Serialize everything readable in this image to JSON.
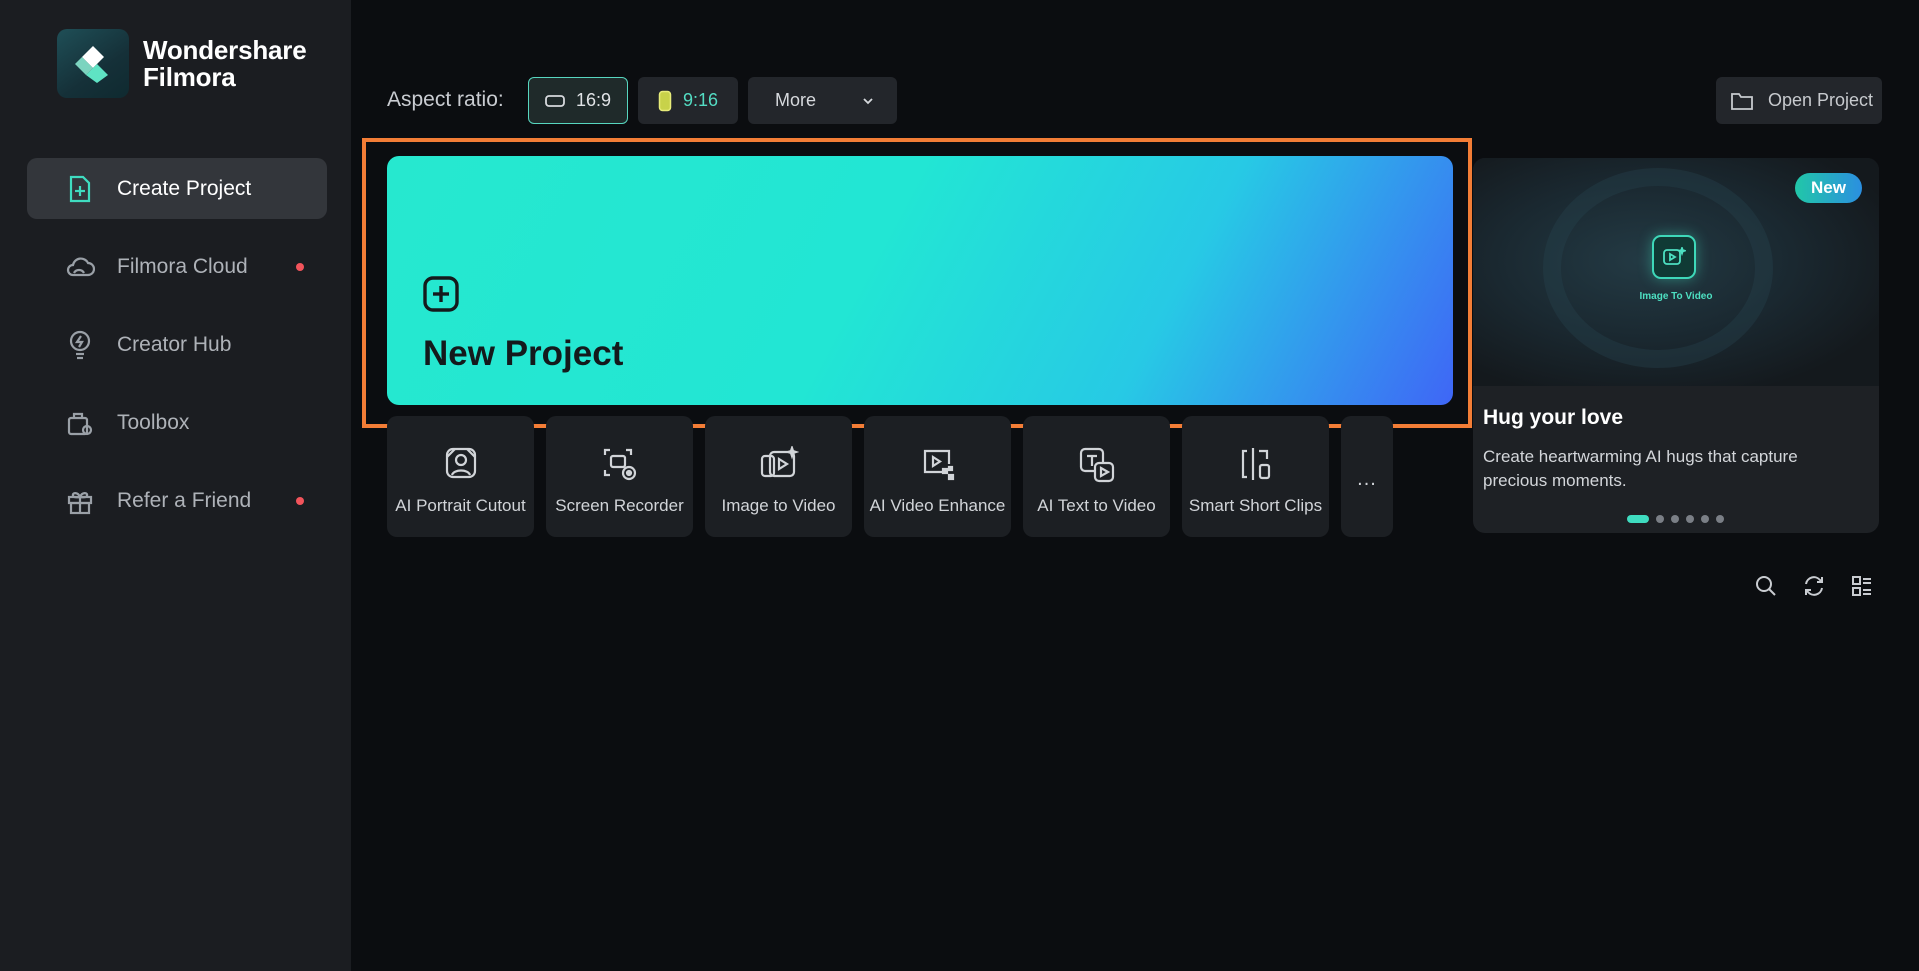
{
  "brand": {
    "line1": "Wondershare",
    "line2": "Filmora"
  },
  "sidebar": {
    "items": [
      {
        "label": "Create Project",
        "icon": "create-project-icon",
        "active": true,
        "dot": false
      },
      {
        "label": "Filmora Cloud",
        "icon": "cloud-icon",
        "active": false,
        "dot": true
      },
      {
        "label": "Creator Hub",
        "icon": "lightbulb-icon",
        "active": false,
        "dot": false
      },
      {
        "label": "Toolbox",
        "icon": "toolbox-icon",
        "active": false,
        "dot": false
      },
      {
        "label": "Refer a Friend",
        "icon": "gift-icon",
        "active": false,
        "dot": true
      }
    ]
  },
  "topbar": {
    "aspect_label": "Aspect ratio:",
    "ratio_16_9": "16:9",
    "ratio_9_16": "9:16",
    "more_label": "More",
    "open_project_label": "Open Project"
  },
  "new_project": {
    "label": "New Project"
  },
  "tools": [
    {
      "label": "AI Portrait Cutout",
      "icon": "portrait-cutout-icon"
    },
    {
      "label": "Screen Recorder",
      "icon": "screen-recorder-icon"
    },
    {
      "label": "Image to Video",
      "icon": "image-to-video-icon"
    },
    {
      "label": "AI Video Enhance",
      "icon": "video-enhance-icon"
    },
    {
      "label": "AI Text to Video",
      "icon": "text-to-video-icon"
    },
    {
      "label": "Smart Short Clips",
      "icon": "short-clips-icon"
    }
  ],
  "tools_more": "...",
  "promo": {
    "badge": "New",
    "hero_caption": "Image To Video",
    "title": "Hug your love",
    "description": "Create heartwarming AI hugs that capture precious moments.",
    "pages": 6,
    "current_page": 1
  },
  "colors": {
    "accent": "#3fdcc0",
    "highlight": "#f37d36",
    "notify_dot": "#f2545b"
  }
}
